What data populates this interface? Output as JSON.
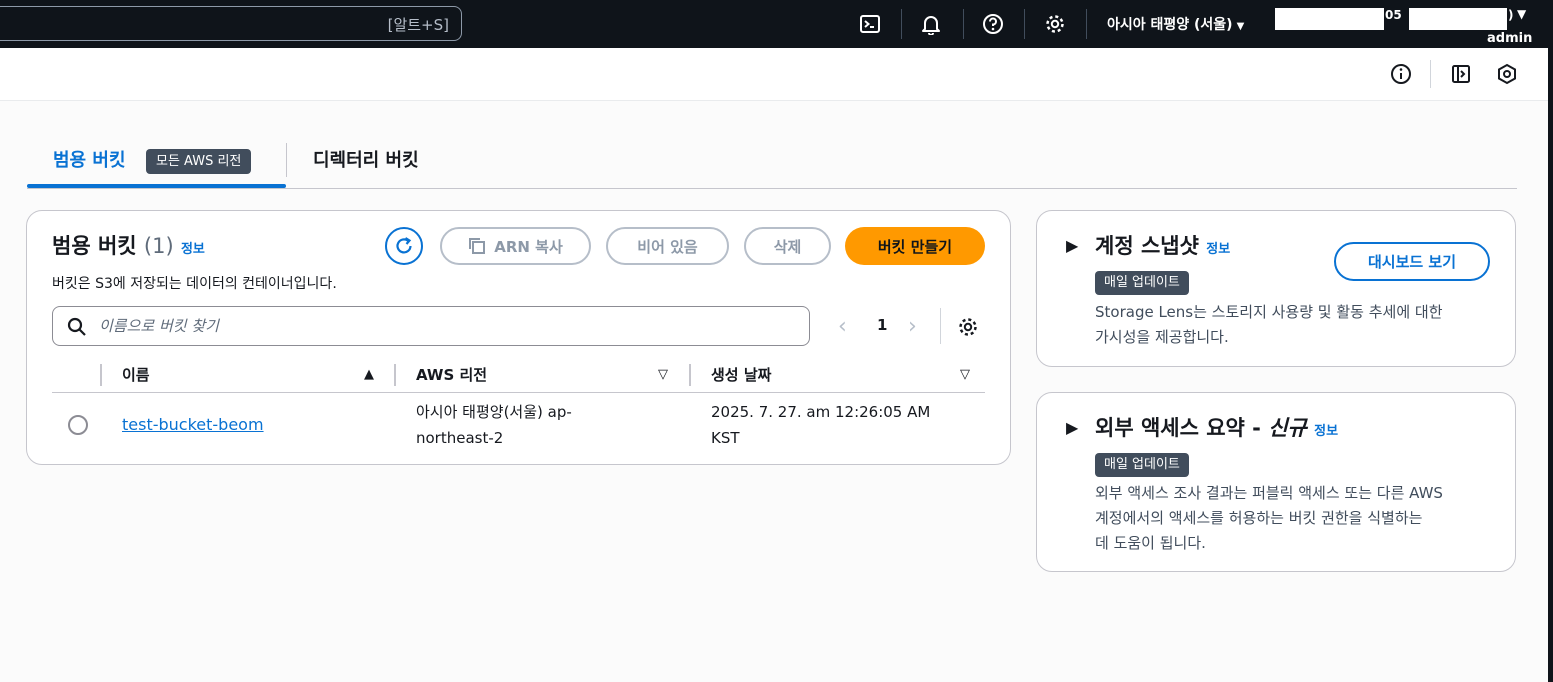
{
  "topnav": {
    "search_shortcut": "[알트+S]",
    "region_label": "아시아 태평양 (서울)",
    "account_fragment_1": "05",
    "account_fragment_2": ")",
    "user_role": "admin"
  },
  "tabs": {
    "general_label": "범용 버킷",
    "general_badge": "모든 AWS 리전",
    "directory_label": "디렉터리 버킷"
  },
  "buckets_panel": {
    "title": "범용 버킷",
    "count": "(1)",
    "info_label": "정보",
    "description": "버킷은 S3에 저장되는 데이터의 컨테이너입니다.",
    "copy_arn_label": "ARN 복사",
    "empty_label": "비어 있음",
    "delete_label": "삭제",
    "create_label": "버킷 만들기",
    "search_placeholder": "이름으로 버킷 찾기",
    "current_page": "1",
    "columns": [
      "이름",
      "AWS 리전",
      "생성 날짜"
    ],
    "rows": [
      {
        "name": "test-bucket-beom",
        "region_line1": "아시아 태평양(서울) ap-",
        "region_line2": "northeast-2",
        "created_line1": "2025. 7. 27. am 12:26:05 AM",
        "created_line2": "KST"
      }
    ]
  },
  "snapshot_card": {
    "title": "계정 스냅샷",
    "info_label": "정보",
    "badge": "매일 업데이트",
    "desc_line1": "Storage Lens는 스토리지 사용량 및 활동 추세에 대한",
    "desc_line2": "가시성을 제공합니다.",
    "dashboard_label": "대시보드 보기"
  },
  "access_card": {
    "title": "외부 액세스 요약 - ",
    "title_new": "신규",
    "info_label": "정보",
    "badge": "매일 업데이트",
    "desc_line1": "외부 액세스 조사 결과는 퍼블릭 액세스 또는 다른 AWS",
    "desc_line2": "계정에서의 액세스를 허용하는 버킷 권한을 식별하는",
    "desc_line3": "데 도움이 됩니다."
  },
  "colors": {
    "accent": "#0972d3",
    "primary_button": "#ff9900",
    "nav_background": "#0f141a"
  }
}
